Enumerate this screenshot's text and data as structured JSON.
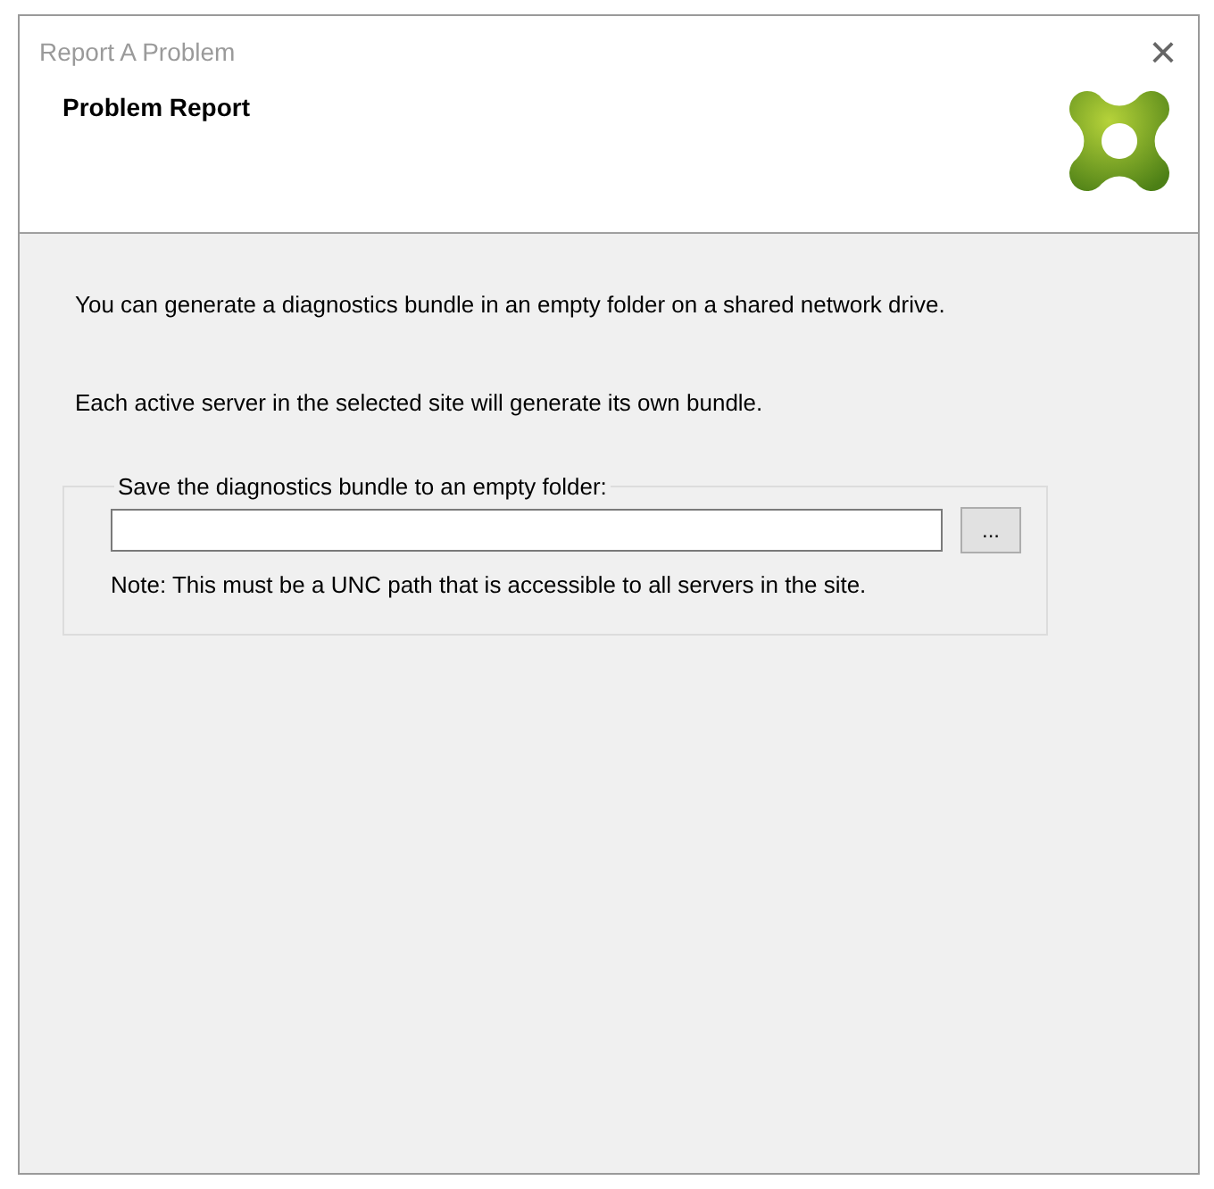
{
  "window": {
    "title": "Report A Problem",
    "close": "×"
  },
  "header": {
    "title": "Problem Report"
  },
  "body": {
    "paragraphs": [
      "You can generate a diagnostics bundle in an empty folder on a shared network drive.",
      "Each active server in the selected site will generate its own bundle."
    ],
    "group": {
      "legend": "Save the diagnostics bundle to an empty folder:",
      "browse_button": "...",
      "note": "Note: This must be a UNC path that is accessible to all servers in the site."
    }
  }
}
